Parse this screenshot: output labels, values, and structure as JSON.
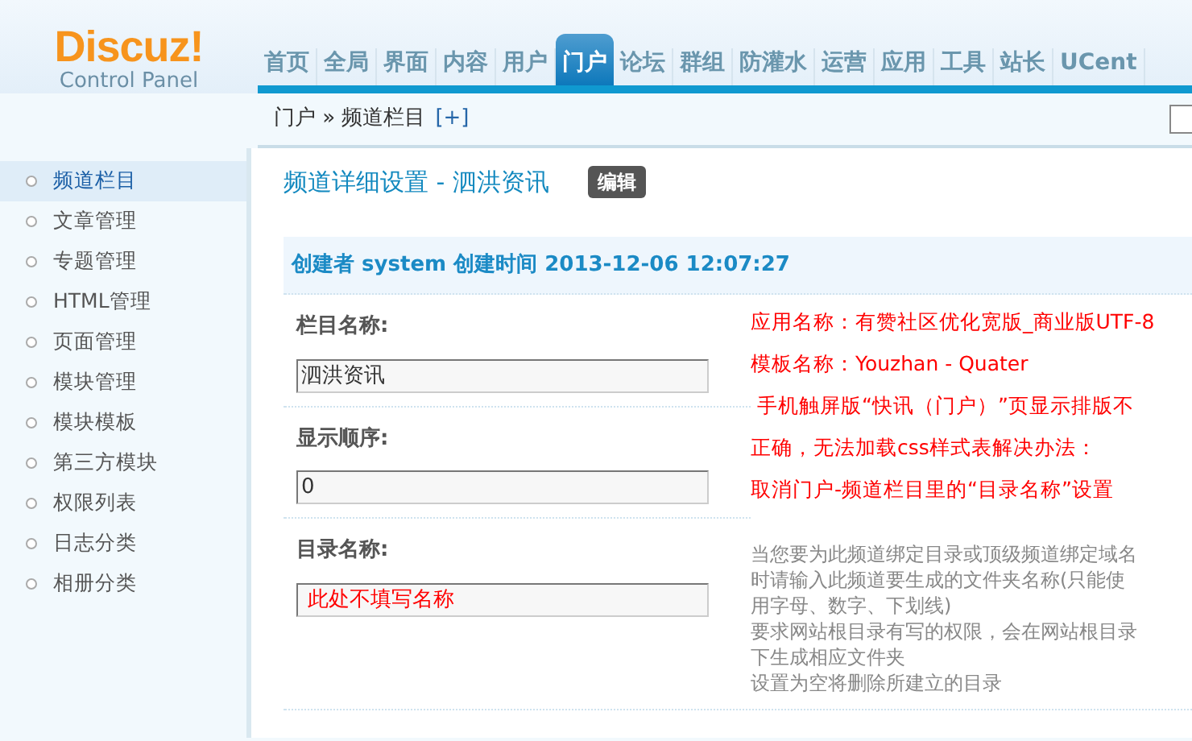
{
  "logo": {
    "title": "Discuz!",
    "subtitle": "Control Panel"
  },
  "nav_tabs": [
    {
      "label": "首页",
      "selected": false
    },
    {
      "label": "全局",
      "selected": false
    },
    {
      "label": "界面",
      "selected": false
    },
    {
      "label": "内容",
      "selected": false
    },
    {
      "label": "用户",
      "selected": false
    },
    {
      "label": "门户",
      "selected": true
    },
    {
      "label": "论坛",
      "selected": false
    },
    {
      "label": "群组",
      "selected": false
    },
    {
      "label": "防灌水",
      "selected": false
    },
    {
      "label": "运营",
      "selected": false
    },
    {
      "label": "应用",
      "selected": false
    },
    {
      "label": "工具",
      "selected": false
    },
    {
      "label": "站长",
      "selected": false
    },
    {
      "label": "UCent",
      "selected": false
    }
  ],
  "breadcrumb": {
    "path": "门户 » 频道栏目",
    "add_link": "[+]"
  },
  "sidebar": {
    "items": [
      {
        "label": "频道栏目",
        "selected": true
      },
      {
        "label": "文章管理",
        "selected": false
      },
      {
        "label": "专题管理",
        "selected": false
      },
      {
        "label": "HTML管理",
        "selected": false
      },
      {
        "label": "页面管理",
        "selected": false
      },
      {
        "label": "模块管理",
        "selected": false
      },
      {
        "label": "模块模板",
        "selected": false
      },
      {
        "label": "第三方模块",
        "selected": false
      },
      {
        "label": "权限列表",
        "selected": false
      },
      {
        "label": "日志分类",
        "selected": false
      },
      {
        "label": "相册分类",
        "selected": false
      }
    ]
  },
  "content": {
    "title": "频道详细设置 - 泗洪资讯",
    "edit_button": "编辑",
    "info_bar": "创建者 system 创建时间 2013-12-06 12:07:27",
    "fields": [
      {
        "label": "栏目名称:",
        "value": "泗洪资讯",
        "annotated": false
      },
      {
        "label": "显示顺序:",
        "value": "0",
        "annotated": false
      },
      {
        "label": "目录名称:",
        "value": "此处不填写名称",
        "annotated": true,
        "hint": [
          "当您要为此频道绑定目录或顶级频道绑定域名",
          "时请输入此频道要生成的文件夹名称(只能使",
          "用字母、数字、下划线)",
          "要求网站根目录有写的权限，会在网站根目录",
          "下生成相应文件夹",
          "设置为空将删除所建立的目录"
        ]
      }
    ],
    "annotation": [
      "应用名称：有赞社区优化宽版_商业版UTF-8",
      "模板名称：Youzhan - Quater",
      " 手机触屏版“快讯（门户）”页显示排版不",
      "正确，无法加载css样式表解决办法：",
      "取消门户-频道栏目里的“目录名称”设置"
    ]
  }
}
